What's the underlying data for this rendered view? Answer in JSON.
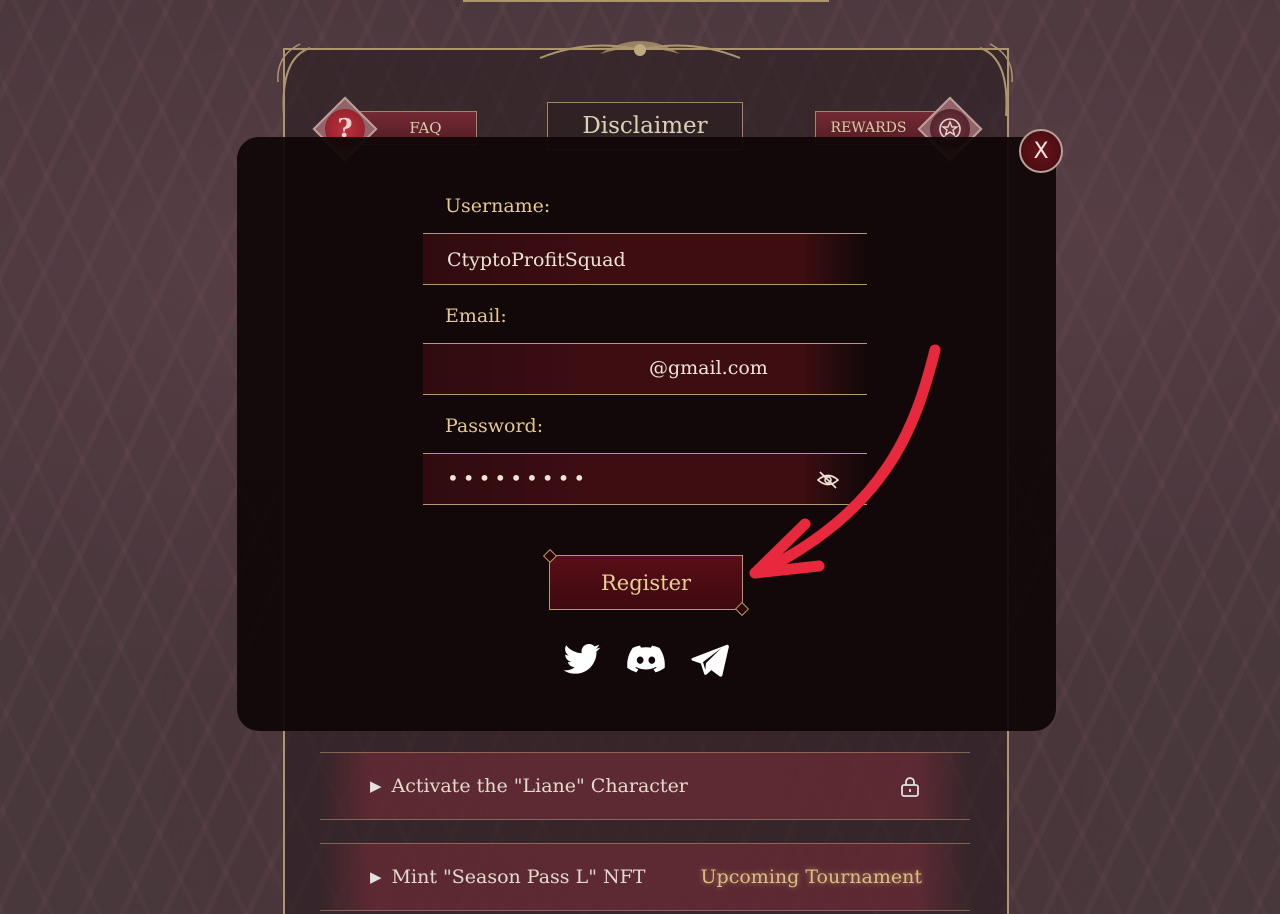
{
  "tabs": {
    "faq": "FAQ",
    "disclaimer": "Disclaimer",
    "rewards": "REWARDS"
  },
  "quests": [
    {
      "label": "Activate the \"Liane\" Character",
      "status": "locked"
    },
    {
      "label": "Mint \"Season Pass L\" NFT",
      "badge": "Upcoming Tournament"
    }
  ],
  "register_modal": {
    "close_label": "X",
    "username": {
      "label": "Username:",
      "value": "CtyptoProfitSquad"
    },
    "email": {
      "label": "Email:",
      "suffix": "@gmail.com"
    },
    "password": {
      "label": "Password:",
      "masked": "•••••••••"
    },
    "register_label": "Register",
    "socials": [
      "twitter-icon",
      "discord-icon",
      "telegram-icon"
    ]
  },
  "colors": {
    "accent_gold": "#e3c98d",
    "button_red": "#5a0e16",
    "annotation_arrow": "#e8283c"
  }
}
